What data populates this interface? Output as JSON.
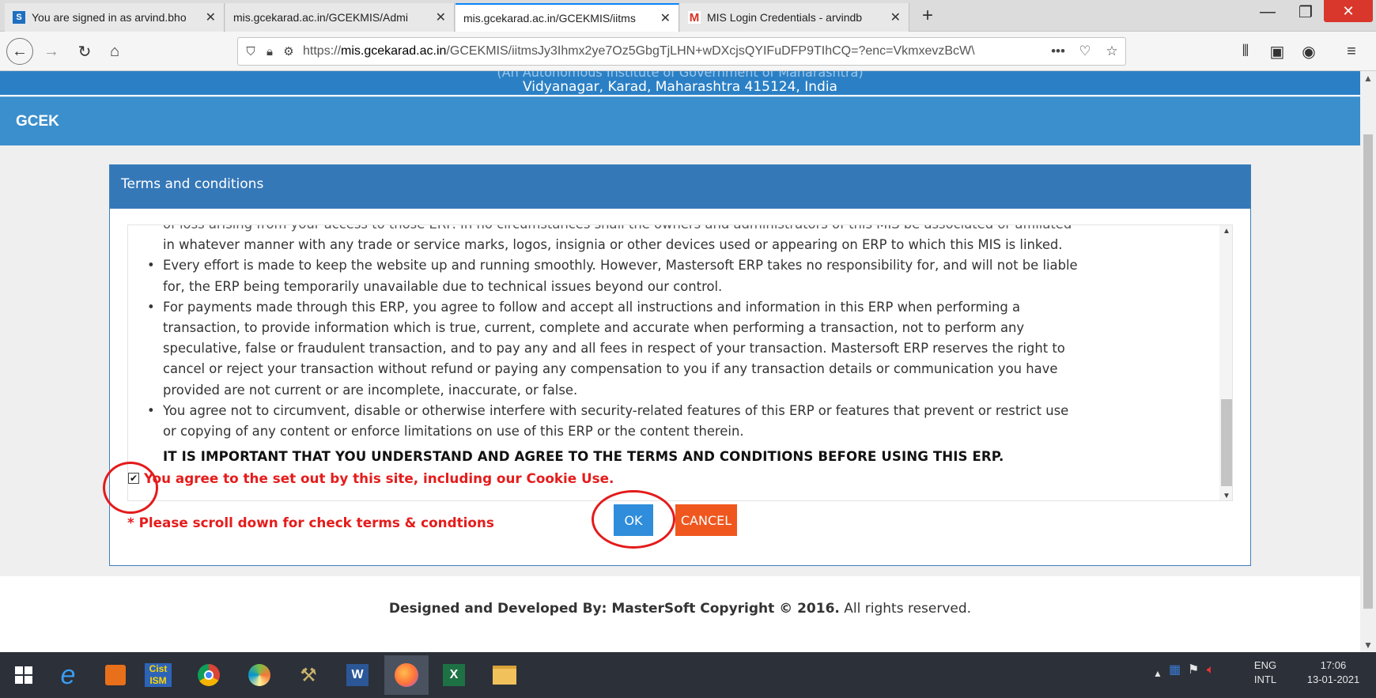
{
  "browser": {
    "tabs": [
      {
        "title": "You are signed in as arvind.bho",
        "favicon": "S",
        "favicon_color": "#1e6fc0"
      },
      {
        "title": "mis.gcekarad.ac.in/GCEKMIS/Admi",
        "favicon": "",
        "favicon_color": ""
      },
      {
        "title": "mis.gcekarad.ac.in/GCEKMIS/iitms",
        "favicon": "",
        "favicon_color": ""
      },
      {
        "title": "MIS Login Credentials - arvindb",
        "favicon": "M",
        "favicon_color": "#d93025"
      }
    ],
    "tab_close": "✕",
    "new_tab": "+",
    "url_domain": "mis.gcekarad.ac.in",
    "url_prefix": "https://",
    "url_rest": "/GCEKMIS/iitmsJy3Ihmx2ye7Oz5GbgTjLHN+wDXcjsQYIFuDFP9TIhCQ=?enc=VkmxevzBcW\\",
    "url_more": "•••"
  },
  "page": {
    "header_cut": "(An Autonomous Institute of Government of Maharashtra)",
    "address": "Vidyanagar, Karad, Maharashtra 415124, India",
    "org_short": "GCEK",
    "modal_title": "Terms and conditions",
    "terms": {
      "partial_top": "of loss arising from your access to those ERP. In no circumstances shall the owners and administrators of this MIS be associated or affiliated",
      "partial_cont": "in whatever manner with any trade or service marks, logos, insignia or other devices used or appearing on ERP to which this MIS is linked.",
      "bullets": [
        [
          "Every effort is made to keep the website up and running smoothly. However, Mastersoft ERP takes no responsibility for, and will not be liable",
          "for, the ERP being temporarily unavailable due to technical issues beyond our control."
        ],
        [
          "For payments made through this ERP, you agree to follow and accept all instructions and information in this ERP when performing a",
          "transaction, to provide information which is true, current, complete and accurate when performing a transaction, not to perform any",
          "speculative, false or fraudulent transaction, and to pay any and all fees in respect of your transaction. Mastersoft ERP reserves the right to",
          "cancel or reject your transaction without refund or paying any compensation to you if any transaction details or communication you have",
          "provided are not current or are incomplete, inaccurate, or false."
        ],
        [
          "You agree not to circumvent, disable or otherwise interfere with security-related features of this ERP or features that prevent or restrict use",
          "or copying of any content or enforce limitations on use of this ERP or the content therein."
        ]
      ],
      "important": "IT IS IMPORTANT THAT YOU UNDERSTAND AND AGREE TO THE TERMS AND CONDITIONS BEFORE USING THIS ERP.",
      "agree_label": "You agree to the set out by this site, including our Cookie Use.",
      "agree_checked": true
    },
    "scroll_warning": "* Please scroll down for check terms & condtions",
    "ok_label": "OK",
    "cancel_label": "CANCEL",
    "footer_bold": "Designed and Developed By: MasterSoft Copyright © 2016.",
    "footer_rest": " All rights reserved."
  },
  "taskbar": {
    "lang_top": "ENG",
    "lang_bottom": "INTL",
    "time": "17:06",
    "date": "13-01-2021"
  },
  "colors": {
    "header_blue": "#2b80c5",
    "modal_head": "#3578b8",
    "ok": "#2f8ddb",
    "cancel": "#f0571e",
    "warning_red": "#e51c1c",
    "annotation_circle": "#e41b1b"
  }
}
